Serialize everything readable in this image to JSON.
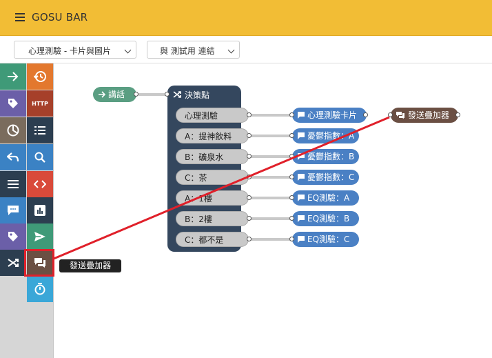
{
  "header": {
    "title": "GOSU BAR"
  },
  "toolbar": {
    "dropdown1": "心理測驗 - 卡片與圖片",
    "dropdown2": "與 測試用 連結"
  },
  "tooltip": "發送疊加器",
  "palette": {
    "http_label": "HTTP"
  },
  "flow": {
    "start_node": "講話",
    "decision_node": "決策點",
    "options": [
      "心理測驗",
      "A：提神飲料",
      "B：礦泉水",
      "C：茶",
      "A：1樓",
      "B：2樓",
      "C：都不是"
    ],
    "outputs": [
      "心理測驗卡片",
      "憂鬱指數：A",
      "憂鬱指數：B",
      "憂鬱指數：C",
      "EQ測驗：A",
      "EQ測驗：B",
      "EQ測驗：C"
    ],
    "sender_node": "發送疊加器"
  },
  "colors": {
    "header": "#f2bd35",
    "decision": "#34475e",
    "output_blue": "#4a80c4",
    "start_teal": "#5a9e82",
    "sender_brown": "#6b4f43",
    "annotation_red": "#e0202a"
  }
}
